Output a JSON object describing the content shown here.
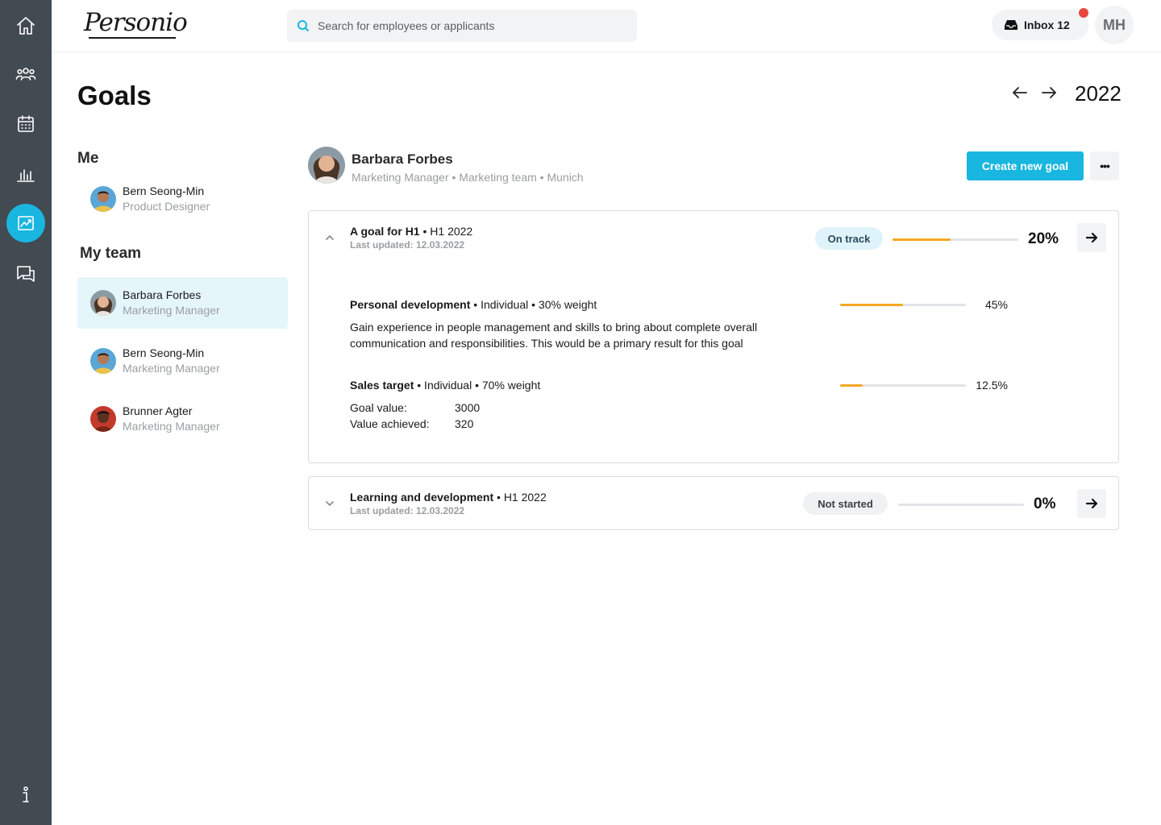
{
  "app": {
    "logo_text": "Personio"
  },
  "sidebar": {
    "items": [
      {
        "icon": "home-icon"
      },
      {
        "icon": "people-icon"
      },
      {
        "icon": "calendar-icon"
      },
      {
        "icon": "bar-chart-icon"
      },
      {
        "icon": "trending-icon",
        "active": true
      },
      {
        "icon": "chat-icon"
      },
      {
        "icon": "info-icon"
      }
    ]
  },
  "topbar": {
    "search_placeholder": "Search for employees or applicants",
    "inbox_label": "Inbox 12",
    "user_initials": "MH"
  },
  "page": {
    "title": "Goals",
    "year": "2022"
  },
  "people": {
    "me_label": "Me",
    "me": {
      "name": "Bern Seong-Min",
      "role": "Product Designer"
    },
    "team_label": "My team",
    "team": [
      {
        "name": "Barbara Forbes",
        "role": "Marketing Manager"
      },
      {
        "name": "Bern Seong-Min",
        "role": "Marketing Manager"
      },
      {
        "name": "Brunner Agter",
        "role": "Marketing Manager"
      }
    ]
  },
  "profile": {
    "name": "Barbara Forbes",
    "meta": "Marketing Manager • Marketing team • Munich",
    "create_label": "Create new goal",
    "more_label": "•••"
  },
  "goals": [
    {
      "name": "A goal for H1",
      "period": " • H1 2022",
      "updated": "Last updated: 12.03.2022",
      "status": "On track",
      "progress_label": "20%",
      "progress": 0.46,
      "key_results": [
        {
          "name": "Personal development",
          "meta": " • Individual • 30% weight",
          "description": "Gain experience in people management and skills to bring about complete overall communication and responsibilities. This would be a primary result for this goal",
          "progress_label": "45%",
          "progress": 0.5
        },
        {
          "name": "Sales target",
          "meta": " • Individual • 70% weight",
          "goal_value_label": "Goal value:",
          "goal_value": "3000",
          "achieved_label": "Value achieved:",
          "achieved_value": "320",
          "progress_label": "12.5%",
          "progress": 0.18
        }
      ]
    },
    {
      "name": "Learning and development",
      "period": " • H1 2022",
      "updated": "Last updated: 12.03.2022",
      "status": "Not started",
      "progress_label": "0%",
      "progress": 0
    }
  ],
  "colors": {
    "sidebar_bg": "#424a52",
    "accent": "#19b6e0",
    "progress": "#f5a623",
    "on_track_bg": "#dff3fa",
    "not_started_bg": "#f0f1f2",
    "notification": "#e8473f"
  }
}
